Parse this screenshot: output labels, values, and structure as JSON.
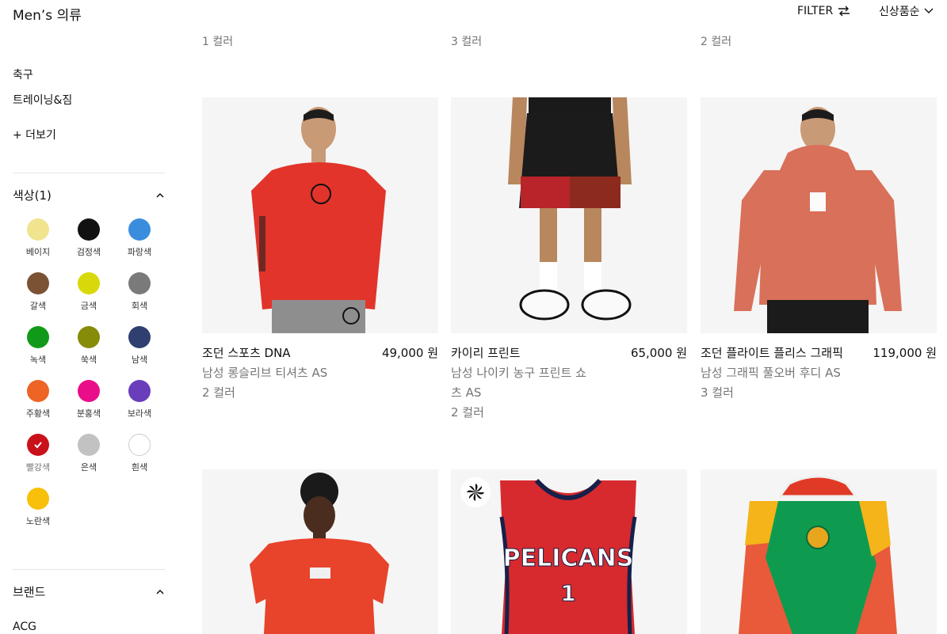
{
  "header": {
    "title": "Men’s 의류",
    "filter_label": "FILTER",
    "sort_label": "신상품순"
  },
  "sidebar": {
    "categories": [
      "축구",
      "트레이닝&짐"
    ],
    "more_label": "+ 더보기",
    "color_section": {
      "title": "색상(1)"
    },
    "colors": [
      {
        "label": "베이지",
        "hex": "#f0e48e"
      },
      {
        "label": "검정색",
        "hex": "#111111"
      },
      {
        "label": "파랑색",
        "hex": "#3a8ddd"
      },
      {
        "label": "갈색",
        "hex": "#7b5234"
      },
      {
        "label": "금색",
        "hex": "#d9d90a"
      },
      {
        "label": "회색",
        "hex": "#7a7a7a"
      },
      {
        "label": "녹색",
        "hex": "#119a19"
      },
      {
        "label": "쑥색",
        "hex": "#868b08"
      },
      {
        "label": "남색",
        "hex": "#2e3f70"
      },
      {
        "label": "주황색",
        "hex": "#ee6424"
      },
      {
        "label": "분홍색",
        "hex": "#ea0d89"
      },
      {
        "label": "보라색",
        "hex": "#6a3dbb"
      },
      {
        "label": "빨강색",
        "hex": "#c9111a",
        "selected": true
      },
      {
        "label": "은색",
        "hex": "#c2c2c2"
      },
      {
        "label": "흰색",
        "hex": "#ffffff"
      },
      {
        "label": "노란색",
        "hex": "#f8c00a"
      }
    ],
    "brand_section": {
      "title": "브랜드"
    },
    "brands": [
      "ACG"
    ]
  },
  "top_color_counts": [
    "1 컬러",
    "3 컬러",
    "2 컬러"
  ],
  "products": [
    {
      "name": "조던 스포츠 DNA",
      "price": "49,000 원",
      "sub": "남성 롱슬리브 티셔츠 AS",
      "colors": "2 컬러"
    },
    {
      "name": "카이리 프린트",
      "price": "65,000 원",
      "sub": "남성 나이키 농구 프린트 쇼츠 AS",
      "colors": "2 컬러"
    },
    {
      "name": "조던 플라이트 플리스 그래픽",
      "price": "119,000 원",
      "sub": "남성 그래픽 풀오버 후디 AS",
      "colors": "3 컬러"
    }
  ],
  "jersey": {
    "team": "PELICANS",
    "number": "1"
  }
}
